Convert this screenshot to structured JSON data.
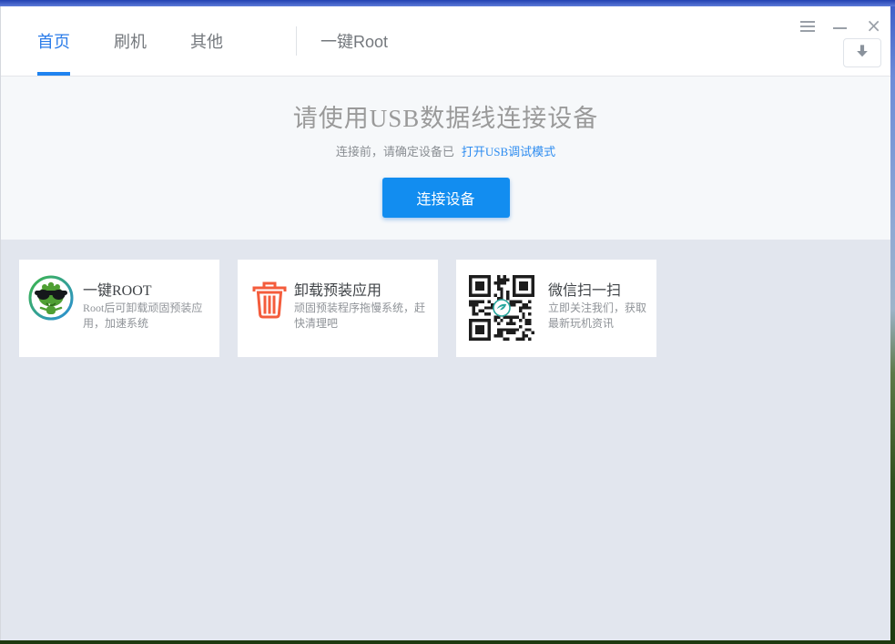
{
  "window_controls": {
    "menu_icon": "hamburger-menu",
    "minimize_icon": "minimize-dash",
    "close_glyph": "×"
  },
  "nav": {
    "tabs": [
      {
        "label": "首页",
        "active": true
      },
      {
        "label": "刷机",
        "active": false
      },
      {
        "label": "其他",
        "active": false
      },
      {
        "label": "一键Root",
        "active": false
      }
    ],
    "download_button_icon": "download-arrow"
  },
  "hero": {
    "title": "请使用USB数据线连接设备",
    "subtitle_prefix": "连接前，请确定设备已",
    "subtitle_link": "打开USB调试模式",
    "connect_button_label": "连接设备"
  },
  "cards": [
    {
      "icon": "root-mascot",
      "title": "一键ROOT",
      "desc": "Root后可卸载顽固预装应用，加速系统"
    },
    {
      "icon": "trash-can",
      "title": "卸载预装应用",
      "desc": "顽固预装程序拖慢系统，赶快清理吧"
    },
    {
      "icon": "wechat-qr-code",
      "title": "微信扫一扫",
      "desc": "立即关注我们，获取最新玩机资讯"
    }
  ],
  "colors": {
    "accent_blue": "#128df0",
    "tab_active_blue": "#2b7ce9",
    "link_blue": "#2d8cf0",
    "trash_orange": "#f45c3c",
    "hero_bg": "#f6f8fa",
    "cards_bg": "#e2e6ee"
  }
}
